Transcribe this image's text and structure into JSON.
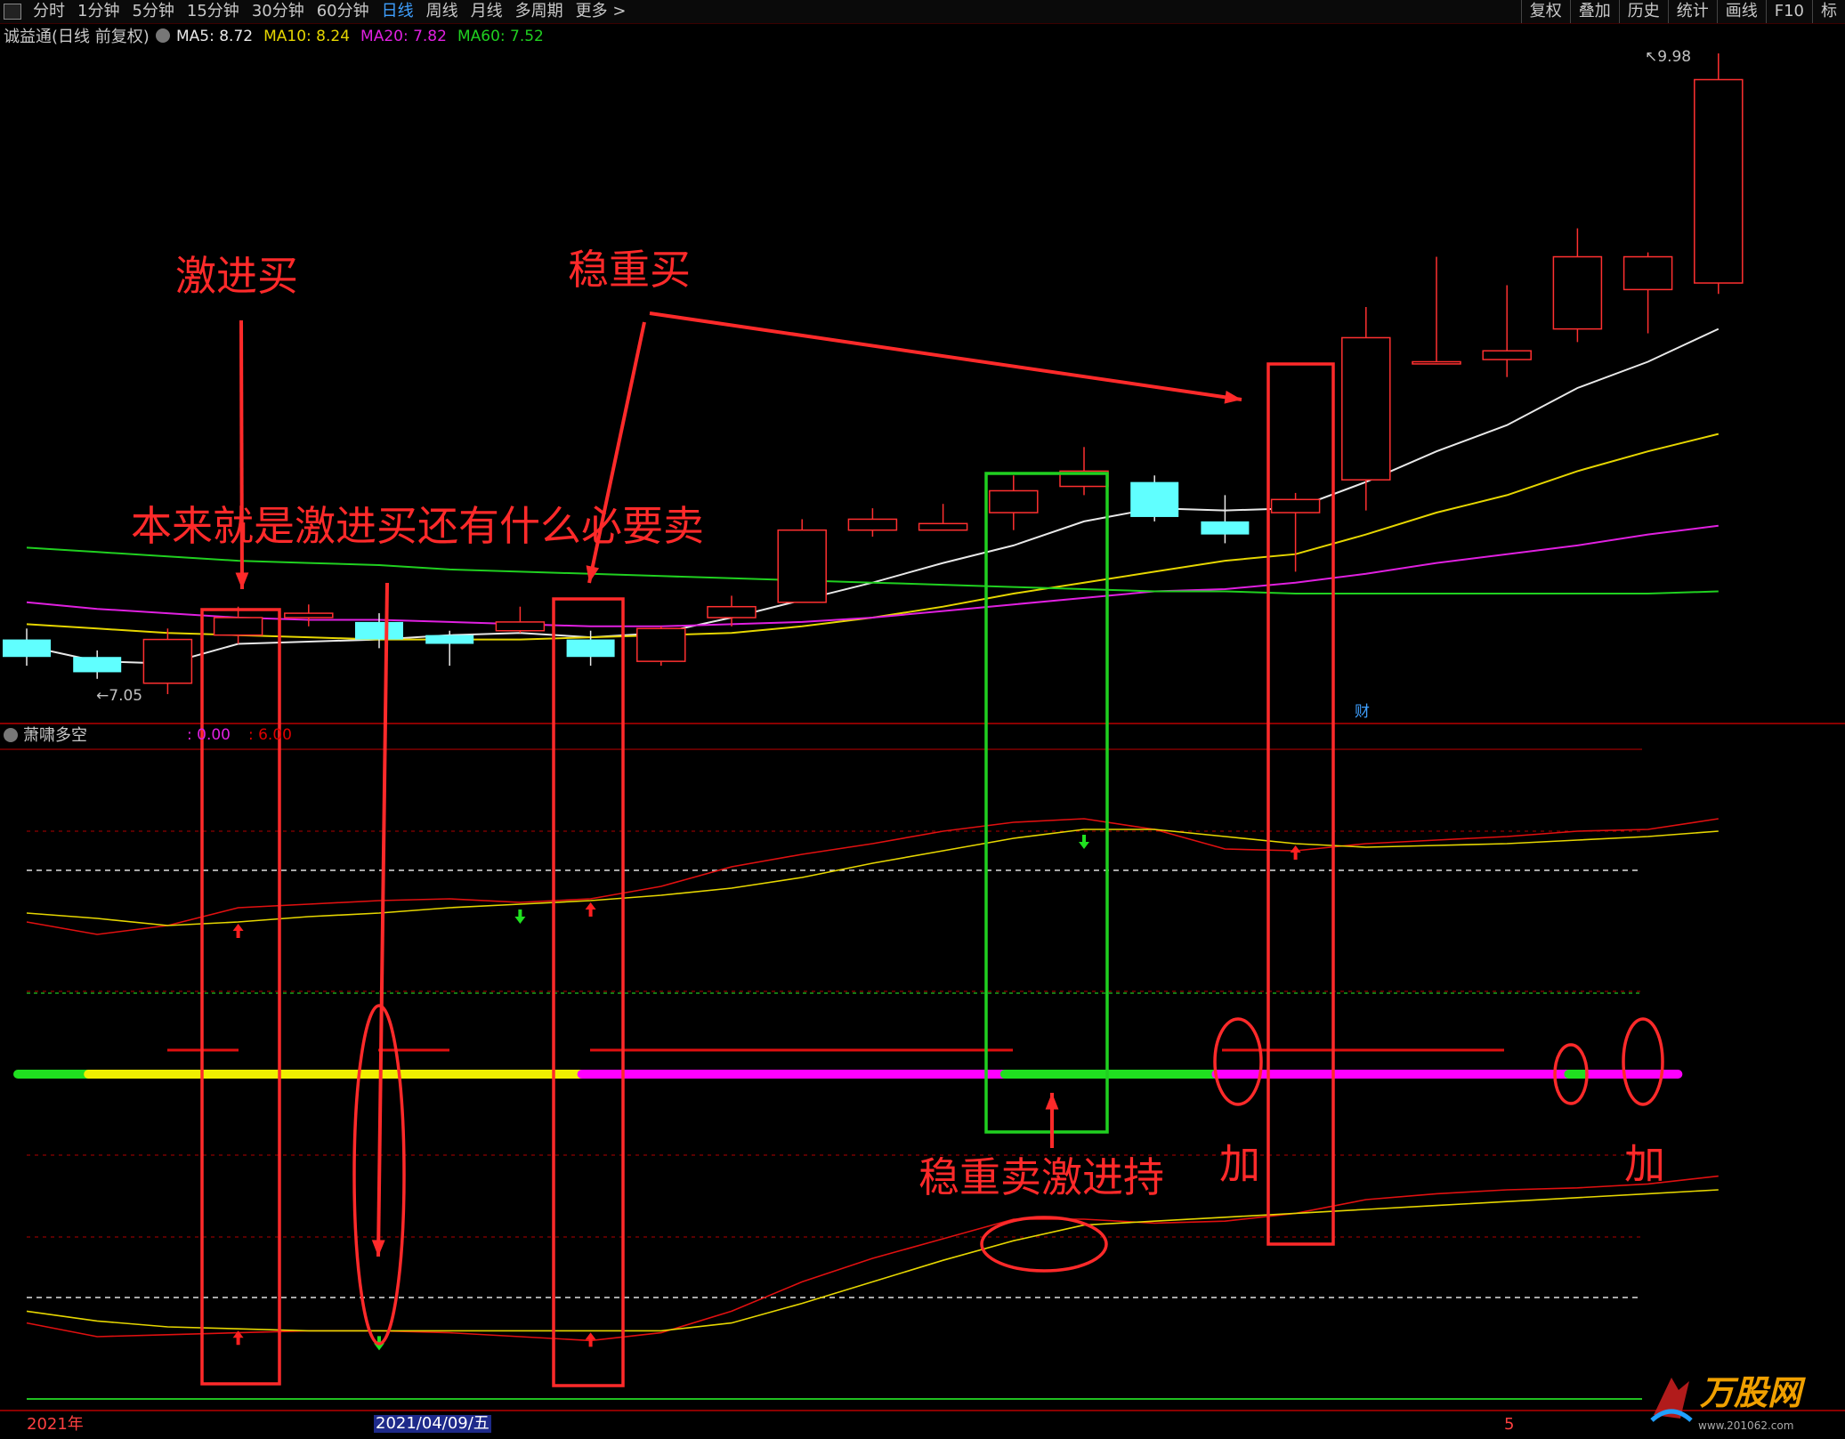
{
  "toolbar": {
    "periods": [
      "分时",
      "1分钟",
      "5分钟",
      "15分钟",
      "30分钟",
      "60分钟",
      "日线",
      "周线",
      "月线",
      "多周期",
      "更多 >"
    ],
    "active_period": "日线",
    "tools": [
      "复权",
      "叠加",
      "历史",
      "统计",
      "画线",
      "F10",
      "标"
    ]
  },
  "main_panel": {
    "title": "诚益通(日线 前复权)",
    "ma": [
      {
        "label": "MA5: 8.72",
        "color": "#e8e8e8"
      },
      {
        "label": "MA10: 8.24",
        "color": "#e6d600"
      },
      {
        "label": "MA20: 7.82",
        "color": "#e020e0"
      },
      {
        "label": "MA60: 7.52",
        "color": "#20d020"
      }
    ],
    "high_label": "9.98",
    "low_label": "7.05",
    "fin_marker": "财"
  },
  "indicator_panel": {
    "title": "萧啸多空",
    "params": [
      {
        "label": ": 0.00",
        "color": "#e020e0"
      },
      {
        "label": ": 6.00",
        "color": "#e00000"
      }
    ]
  },
  "time_axis": {
    "start_label": "2021年",
    "cursor_label": "2021/04/09/五",
    "end_label": "5"
  },
  "annotations": {
    "aggressive_buy": "激进买",
    "steady_buy": "稳重买",
    "no_need_sell": "本来就是激进买还有什么必要卖",
    "steady_sell_aggressive_hold": "稳重卖激进持",
    "add_1": "加",
    "add_2": "加"
  },
  "watermark": {
    "name": "万股网",
    "url": "www.201062.com"
  },
  "colors": {
    "up": "#ff3030",
    "down": "#60ffff",
    "ma5": "#e8e8e8",
    "ma10": "#e6d600",
    "ma20": "#e020e0",
    "ma60": "#20d020",
    "annotation": "#ff2a2a"
  },
  "chart_data": {
    "type": "candlestick",
    "interval": "daily",
    "price_range": [
      7.05,
      9.98
    ],
    "candles": [
      {
        "o": 7.3,
        "c": 7.22,
        "h": 7.35,
        "l": 7.18
      },
      {
        "o": 7.22,
        "c": 7.15,
        "h": 7.25,
        "l": 7.12
      },
      {
        "o": 7.1,
        "c": 7.3,
        "h": 7.35,
        "l": 7.05
      },
      {
        "o": 7.32,
        "c": 7.4,
        "h": 7.45,
        "l": 7.28
      },
      {
        "o": 7.4,
        "c": 7.42,
        "h": 7.46,
        "l": 7.36
      },
      {
        "o": 7.38,
        "c": 7.3,
        "h": 7.42,
        "l": 7.26
      },
      {
        "o": 7.32,
        "c": 7.28,
        "h": 7.34,
        "l": 7.18
      },
      {
        "o": 7.34,
        "c": 7.38,
        "h": 7.45,
        "l": 7.33
      },
      {
        "o": 7.3,
        "c": 7.22,
        "h": 7.34,
        "l": 7.18
      },
      {
        "o": 7.2,
        "c": 7.35,
        "h": 7.36,
        "l": 7.18
      },
      {
        "o": 7.4,
        "c": 7.45,
        "h": 7.5,
        "l": 7.36
      },
      {
        "o": 7.47,
        "c": 7.8,
        "h": 7.85,
        "l": 7.47
      },
      {
        "o": 7.8,
        "c": 7.85,
        "h": 7.9,
        "l": 7.77
      },
      {
        "o": 7.8,
        "c": 7.83,
        "h": 7.92,
        "l": 7.8
      },
      {
        "o": 7.88,
        "c": 7.98,
        "h": 8.05,
        "l": 7.8
      },
      {
        "o": 8.0,
        "c": 8.07,
        "h": 8.18,
        "l": 7.96
      },
      {
        "o": 8.02,
        "c": 7.86,
        "h": 8.05,
        "l": 7.84
      },
      {
        "o": 7.84,
        "c": 7.78,
        "h": 7.96,
        "l": 7.74
      },
      {
        "o": 7.88,
        "c": 7.94,
        "h": 7.97,
        "l": 7.61
      },
      {
        "o": 8.03,
        "c": 8.68,
        "h": 8.82,
        "l": 7.89
      },
      {
        "o": 8.56,
        "c": 8.57,
        "h": 9.05,
        "l": 8.56
      },
      {
        "o": 8.58,
        "c": 8.62,
        "h": 8.92,
        "l": 8.5
      },
      {
        "o": 8.72,
        "c": 9.05,
        "h": 9.18,
        "l": 8.66
      },
      {
        "o": 8.9,
        "c": 9.05,
        "h": 9.07,
        "l": 8.7
      },
      {
        "o": 8.93,
        "c": 9.86,
        "h": 9.98,
        "l": 8.88
      }
    ],
    "ma_series": [
      {
        "name": "MA5",
        "values": [
          7.27,
          7.2,
          7.19,
          7.28,
          7.29,
          7.3,
          7.32,
          7.33,
          7.31,
          7.33,
          7.4,
          7.48,
          7.56,
          7.65,
          7.73,
          7.84,
          7.9,
          7.89,
          7.9,
          8.02,
          8.16,
          8.28,
          8.45,
          8.57,
          8.72
        ]
      },
      {
        "name": "MA10",
        "values": [
          7.37,
          7.35,
          7.33,
          7.32,
          7.31,
          7.3,
          7.3,
          7.3,
          7.31,
          7.32,
          7.33,
          7.36,
          7.4,
          7.45,
          7.51,
          7.56,
          7.61,
          7.66,
          7.69,
          7.78,
          7.88,
          7.96,
          8.07,
          8.16,
          8.24
        ]
      },
      {
        "name": "MA20",
        "values": [
          7.47,
          7.44,
          7.42,
          7.4,
          7.39,
          7.39,
          7.38,
          7.37,
          7.36,
          7.36,
          7.37,
          7.38,
          7.4,
          7.43,
          7.46,
          7.49,
          7.52,
          7.53,
          7.56,
          7.6,
          7.65,
          7.69,
          7.73,
          7.78,
          7.82
        ]
      },
      {
        "name": "MA60",
        "values": [
          7.72,
          7.7,
          7.68,
          7.66,
          7.65,
          7.64,
          7.62,
          7.61,
          7.6,
          7.59,
          7.58,
          7.57,
          7.56,
          7.55,
          7.54,
          7.53,
          7.52,
          7.52,
          7.51,
          7.51,
          7.51,
          7.51,
          7.51,
          7.51,
          7.52
        ]
      }
    ],
    "indicator_upper": {
      "red": [
        0.22,
        0.15,
        0.2,
        0.3,
        0.32,
        0.34,
        0.35,
        0.33,
        0.35,
        0.42,
        0.53,
        0.6,
        0.66,
        0.73,
        0.78,
        0.8,
        0.74,
        0.63,
        0.62,
        0.66,
        0.68,
        0.7,
        0.73,
        0.74,
        0.8
      ],
      "yellow": [
        0.27,
        0.24,
        0.2,
        0.22,
        0.25,
        0.27,
        0.3,
        0.32,
        0.34,
        0.37,
        0.41,
        0.47,
        0.55,
        0.62,
        0.69,
        0.74,
        0.74,
        0.7,
        0.66,
        0.64,
        0.65,
        0.66,
        0.68,
        0.7,
        0.73
      ],
      "signals": [
        {
          "bar": 3,
          "type": "up"
        },
        {
          "bar": 7,
          "type": "down"
        },
        {
          "bar": 8,
          "type": "up"
        },
        {
          "bar": 15,
          "type": "down"
        },
        {
          "bar": 18,
          "type": "up"
        }
      ]
    },
    "state_bar": [
      {
        "from": 0,
        "to": 1,
        "state": "green"
      },
      {
        "from": 1,
        "to": 8,
        "state": "yellow"
      },
      {
        "from": 8,
        "to": 14,
        "state": "magenta"
      },
      {
        "from": 14,
        "to": 17,
        "state": "green"
      },
      {
        "from": 17,
        "to": 22,
        "state": "magenta"
      },
      {
        "from": 22,
        "to": 22.3,
        "state": "green"
      },
      {
        "from": 22.3,
        "to": 23.3,
        "state": "magenta"
      }
    ],
    "indicator_lower": {
      "red": [
        0.22,
        0.15,
        0.16,
        0.17,
        0.18,
        0.18,
        0.17,
        0.15,
        0.13,
        0.17,
        0.28,
        0.43,
        0.55,
        0.65,
        0.75,
        0.75,
        0.73,
        0.74,
        0.78,
        0.85,
        0.88,
        0.9,
        0.91,
        0.93,
        0.97
      ],
      "yellow": [
        0.28,
        0.23,
        0.2,
        0.19,
        0.18,
        0.18,
        0.18,
        0.18,
        0.18,
        0.18,
        0.22,
        0.32,
        0.43,
        0.54,
        0.64,
        0.72,
        0.74,
        0.76,
        0.78,
        0.8,
        0.82,
        0.84,
        0.86,
        0.88,
        0.9
      ],
      "signals": [
        {
          "bar": 3,
          "type": "up"
        },
        {
          "bar": 5,
          "type": "down"
        },
        {
          "bar": 8,
          "type": "up"
        }
      ]
    }
  }
}
